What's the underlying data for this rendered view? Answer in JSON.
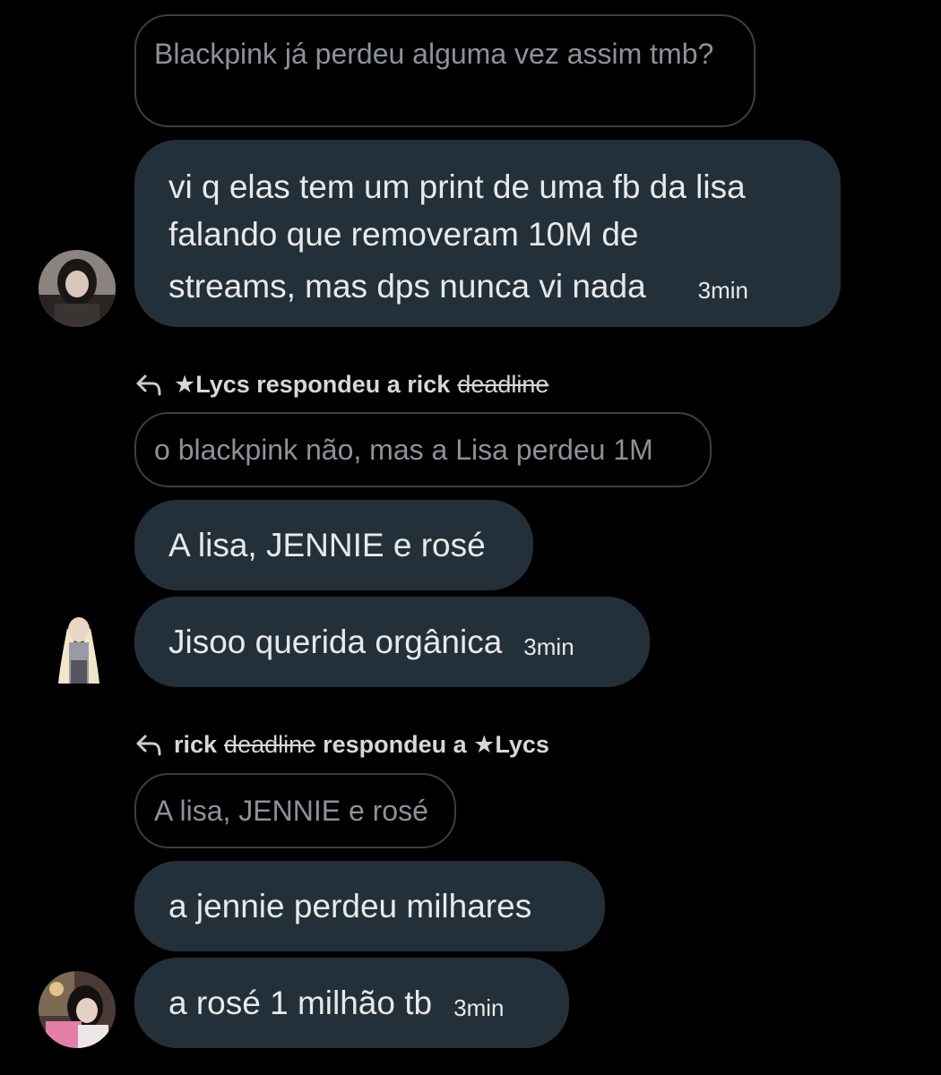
{
  "messages": {
    "q1": "Blackpink já perdeu alguma vez assim tmb?",
    "b1_line1": "vi q elas tem um print de uma fb da lisa",
    "b1_line2": "falando que removeram 10M de",
    "b1_line3": "streams, mas dps nunca vi nada",
    "b1_time": "3min",
    "reply1_prefix": "★Lycs respondeu a rick",
    "reply1_strike": "deadline",
    "q2": "o blackpink não, mas a Lisa perdeu 1M",
    "b2": "A lisa, JENNIE e rosé",
    "b3": "Jisoo querida orgânica",
    "b3_time": "3min",
    "reply2_name": "rick",
    "reply2_strike": "deadline",
    "reply2_suffix": "respondeu a ★Lycs",
    "q3": "A lisa, JENNIE e rosé",
    "b4": "a jennie perdeu milhares",
    "b5": "a rosé 1 milhão tb",
    "b5_time": "3min"
  },
  "icons": {
    "reply": "reply-arrow-icon",
    "avatar": "user-avatar"
  },
  "colors": {
    "background": "#000000",
    "bubble": "#243039",
    "quote_border": "#3a3f44",
    "text": "#e7e9ea",
    "muted": "#8b9298"
  }
}
